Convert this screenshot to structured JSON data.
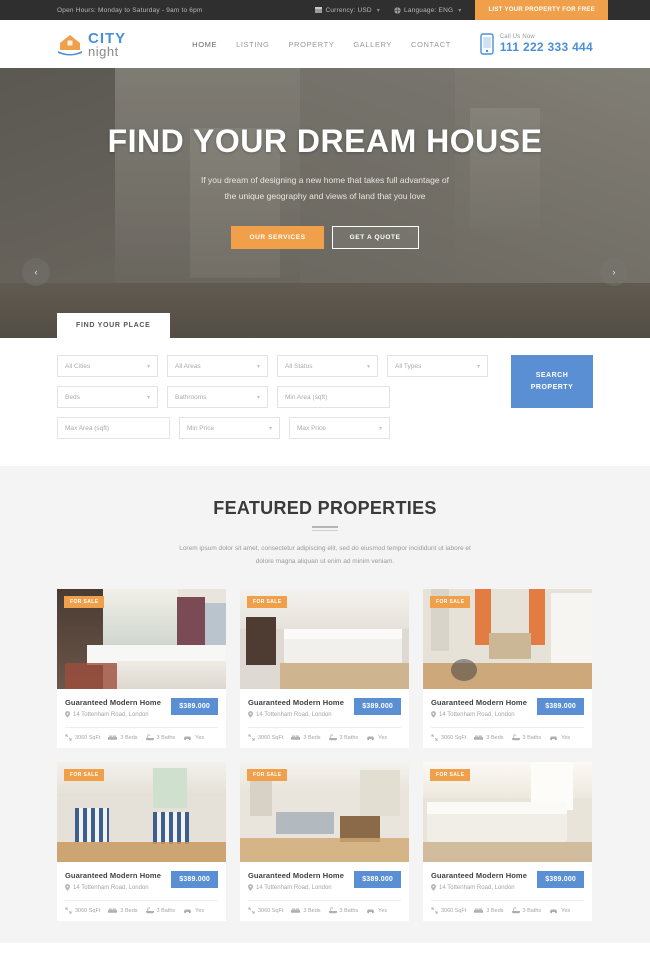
{
  "topbar": {
    "hours": "Open Hours: Monday to Saturday - 9am to 6pm",
    "currency_label": "Currency: USD",
    "currency_icon": "flag-icon",
    "language_label": "Language: ENG",
    "language_icon": "globe-icon",
    "cta": "LIST YOUR PROPERTY FOR FREE",
    "bg": "#2f2f2f",
    "cta_bg": "#f0a04b"
  },
  "header": {
    "logo": {
      "primary": "CITY",
      "secondary": "night",
      "icon": "house-logo-icon",
      "primary_color": "#4a90d9"
    },
    "nav": [
      {
        "label": "HOME",
        "active": true
      },
      {
        "label": "LISTING",
        "active": false
      },
      {
        "label": "PROPERTY",
        "active": false
      },
      {
        "label": "GALLERY",
        "active": false
      },
      {
        "label": "CONTACT",
        "active": false
      }
    ],
    "call": {
      "label": "Call Us Now",
      "number": "111 222 333 444",
      "icon": "mobile-phone-icon",
      "color": "#4a90d9"
    }
  },
  "hero": {
    "title": "FIND YOUR DREAM HOUSE",
    "subtitle_line1": "If you dream of designing a new home that takes full advantage of",
    "subtitle_line2": "the unique geography and views of land that you love",
    "btn_primary": "OUR SERVICES",
    "btn_secondary": "GET A QUOTE",
    "prev_icon": "chevron-left-icon",
    "next_icon": "chevron-right-icon",
    "prev_glyph": "‹",
    "next_glyph": "›",
    "tab_label": "FIND YOUR PLACE"
  },
  "search": {
    "fields": [
      {
        "label": "All Cities",
        "type": "select"
      },
      {
        "label": "All Areas",
        "type": "select"
      },
      {
        "label": "All Status",
        "type": "select"
      },
      {
        "label": "All Types",
        "type": "select"
      },
      {
        "label": "Beds",
        "type": "select"
      },
      {
        "label": "Bathrooms",
        "type": "select"
      },
      {
        "label": "Min Area (sqft)",
        "type": "input"
      },
      {
        "label": "Max Area (sqft)",
        "type": "input"
      },
      {
        "label": "Min Price",
        "type": "select"
      },
      {
        "label": "Max Price",
        "type": "select"
      }
    ],
    "button_line1": "SEARCH",
    "button_line2": "PROPERTY",
    "button_bg": "#5b8fd4",
    "caret_glyph": "∨"
  },
  "featured": {
    "title": "FEATURED PROPERTIES",
    "subtitle_line1": "Lorem ipsum dolor sit amet, consectetur adipiscing elit, sed do eiusmod tempor incididunt ut",
    "subtitle_line2": "labore et dolore magna aliquan ut enim ad minim veniam.",
    "bg": "#f4f4f4",
    "cards": [
      {
        "badge": "FOR SALE",
        "title": "Guaranteed Modern Home",
        "address": "14 Tottenham Road, London",
        "price": "$389.000",
        "image": "kitchen-with-island-and-rug",
        "feats": [
          {
            "icon": "area-icon",
            "label": "3060 SqFt"
          },
          {
            "icon": "bed-icon",
            "label": "3 Beds"
          },
          {
            "icon": "bath-icon",
            "label": "3 Baths"
          },
          {
            "icon": "garage-car-icon",
            "label": "Yes"
          }
        ]
      },
      {
        "badge": "FOR SALE",
        "title": "Guaranteed Modern Home",
        "address": "14 Tottenham Road, London",
        "price": "$389.000",
        "image": "bedroom-with-white-bedding",
        "feats": [
          {
            "icon": "area-icon",
            "label": "3060 SqFt"
          },
          {
            "icon": "bed-icon",
            "label": "3 Beds"
          },
          {
            "icon": "bath-icon",
            "label": "3 Baths"
          },
          {
            "icon": "garage-car-icon",
            "label": "Yes"
          }
        ]
      },
      {
        "badge": "FOR SALE",
        "title": "Guaranteed Modern Home",
        "address": "14 Tottenham Road, London",
        "price": "$389.000",
        "image": "dining-nook-with-orange-curtains",
        "feats": [
          {
            "icon": "area-icon",
            "label": "3060 SqFt"
          },
          {
            "icon": "bed-icon",
            "label": "3 Beds"
          },
          {
            "icon": "bath-icon",
            "label": "3 Baths"
          },
          {
            "icon": "garage-car-icon",
            "label": "Yes"
          }
        ]
      },
      {
        "badge": "FOR SALE",
        "title": "Guaranteed Modern Home",
        "address": "14 Tottenham Road, London",
        "price": "$389.000",
        "image": "living-room-with-striped-chairs",
        "feats": [
          {
            "icon": "area-icon",
            "label": "3060 SqFt"
          },
          {
            "icon": "bed-icon",
            "label": "3 Beds"
          },
          {
            "icon": "bath-icon",
            "label": "3 Baths"
          },
          {
            "icon": "garage-car-icon",
            "label": "Yes"
          }
        ]
      },
      {
        "badge": "FOR SALE",
        "title": "Guaranteed Modern Home",
        "address": "14 Tottenham Road, London",
        "price": "$389.000",
        "image": "living-room-with-coffee-table",
        "feats": [
          {
            "icon": "area-icon",
            "label": "3060 SqFt"
          },
          {
            "icon": "bed-icon",
            "label": "3 Beds"
          },
          {
            "icon": "bath-icon",
            "label": "3 Baths"
          },
          {
            "icon": "garage-car-icon",
            "label": "Yes"
          }
        ]
      },
      {
        "badge": "FOR SALE",
        "title": "Guaranteed Modern Home",
        "address": "14 Tottenham Road, London",
        "price": "$389.000",
        "image": "bedroom-with-sunlit-window",
        "feats": [
          {
            "icon": "area-icon",
            "label": "3060 SqFt"
          },
          {
            "icon": "bed-icon",
            "label": "3 Beds"
          },
          {
            "icon": "bath-icon",
            "label": "3 Baths"
          },
          {
            "icon": "garage-car-icon",
            "label": "Yes"
          }
        ]
      }
    ]
  }
}
